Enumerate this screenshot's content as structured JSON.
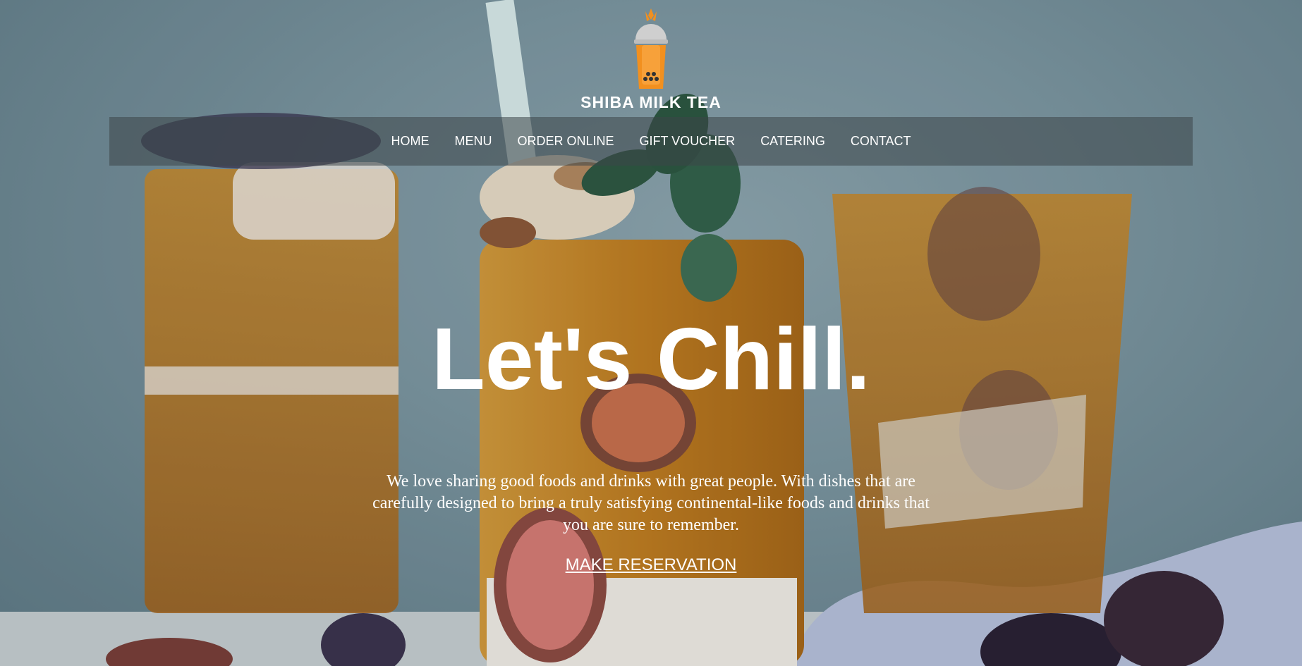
{
  "brand": {
    "name": "SHIBA MILK TEA",
    "logo_icon": "boba-cup-icon"
  },
  "nav": {
    "items": [
      {
        "label": "HOME"
      },
      {
        "label": "MENU"
      },
      {
        "label": "ORDER ONLINE"
      },
      {
        "label": "GIFT VOUCHER"
      },
      {
        "label": "CATERING"
      },
      {
        "label": "CONTACT"
      }
    ]
  },
  "hero": {
    "headline": "Let's Chill.",
    "intro": "We love sharing good foods and drinks with great people. With dishes that are carefully designed to bring a truly satisfying continental-like foods and drinks that you are sure to remember.",
    "cta_label": "MAKE RESERVATION"
  },
  "colors": {
    "accent": "#f2901f",
    "nav_bg": "rgba(60,70,72,0.55)",
    "text": "#ffffff"
  }
}
